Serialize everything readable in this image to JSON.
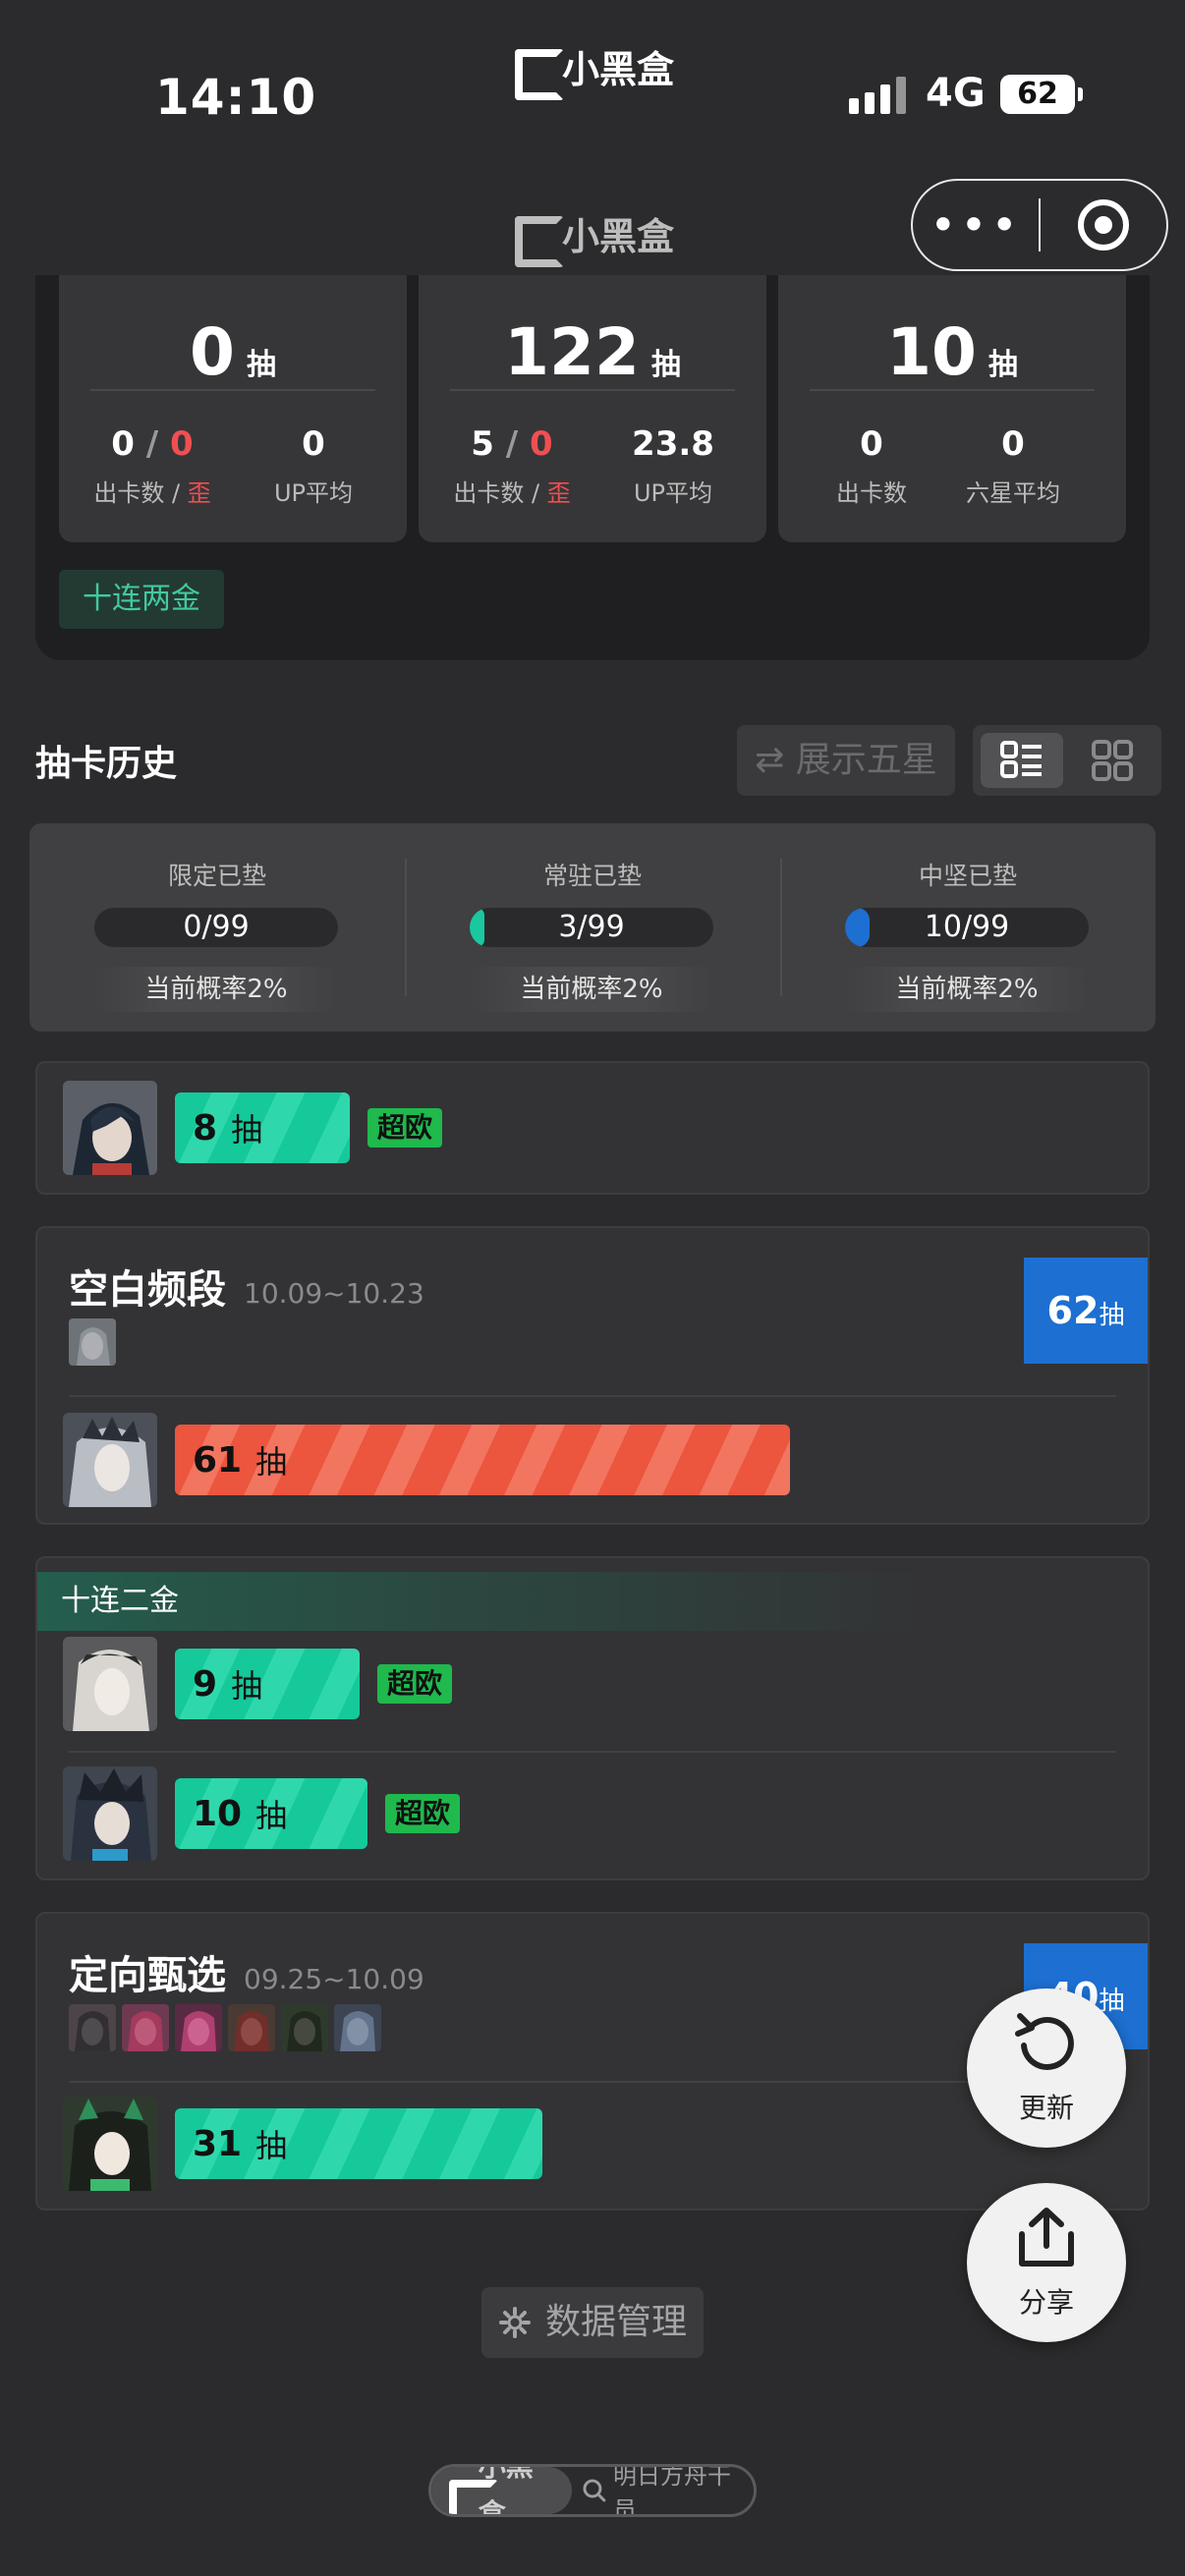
{
  "status_bar": {
    "time": "14:10",
    "app_name": "小黑盒",
    "network": "4G",
    "battery": "62"
  },
  "nav": {
    "title": "小黑盒",
    "more_label": "•••"
  },
  "summary": {
    "cards": [
      {
        "count": "0",
        "unit": "抽",
        "left_value_a": "0",
        "left_value_b": "0",
        "left_label_a": "出卡数",
        "left_label_b": "歪",
        "right_value": "0",
        "right_label": "UP平均"
      },
      {
        "count": "122",
        "unit": "抽",
        "left_value_a": "5",
        "left_value_b": "0",
        "left_label_a": "出卡数",
        "left_label_b": "歪",
        "right_value": "23.8",
        "right_label": "UP平均"
      },
      {
        "count": "10",
        "unit": "抽",
        "left_value": "0",
        "left_label": "出卡数",
        "right_value": "0",
        "right_label": "六星平均"
      }
    ],
    "slash": "/",
    "tag": "十连两金"
  },
  "history": {
    "title": "抽卡历史",
    "five_star_toggle": "⇄ 展示五星",
    "pity": [
      {
        "title": "限定已垫",
        "value": "0/99",
        "progress": 0,
        "color": "#1ac8a0",
        "rate": "当前概率2%"
      },
      {
        "title": "常驻已垫",
        "value": "3/99",
        "progress": 0.0303,
        "color": "#1ac8a0",
        "rate": "当前概率2%"
      },
      {
        "title": "中坚已垫",
        "value": "10/99",
        "progress": 0.101,
        "color": "#1d6fd1",
        "rate": "当前概率2%"
      }
    ]
  },
  "records": {
    "r1": {
      "pulls": "8",
      "unit": "抽",
      "badge": "超欧"
    },
    "banner1": {
      "name": "空白频段",
      "date": "10.09~10.23",
      "total": "62",
      "unit": "抽",
      "pulls": "61"
    },
    "group2": {
      "ribbon": "十连二金",
      "a_pulls": "9",
      "a_badge": "超欧",
      "b_pulls": "10",
      "b_badge": "超欧",
      "unit": "抽"
    },
    "banner2": {
      "name": "定向甄选",
      "date": "09.25~10.09",
      "total": "40",
      "unit": "抽",
      "pulls": "31"
    }
  },
  "fabs": {
    "refresh": "更新",
    "share": "分享"
  },
  "data_manage": "数据管理",
  "footer": {
    "brand": "小黑盒",
    "game": "明日方舟干员"
  }
}
